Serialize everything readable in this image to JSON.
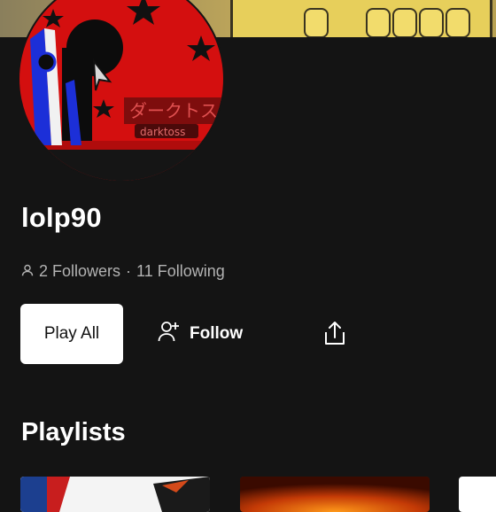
{
  "profile": {
    "username": "lolp90",
    "followers_text": "2 Followers",
    "separator": "·",
    "following_text": "11 Following",
    "avatar_text_jp": "ダークトス",
    "avatar_text_en": "darktoss"
  },
  "actions": {
    "play_all_label": "Play All",
    "follow_label": "Follow"
  },
  "sections": {
    "playlists_title": "Playlists"
  },
  "icons": [
    "person-icon",
    "person-add-icon",
    "share-icon"
  ],
  "colors": {
    "background": "#141414",
    "text": "#ffffff",
    "muted_text": "#b3b3b3",
    "primary_button_bg": "#ffffff",
    "avatar_red": "#d40f0f"
  }
}
